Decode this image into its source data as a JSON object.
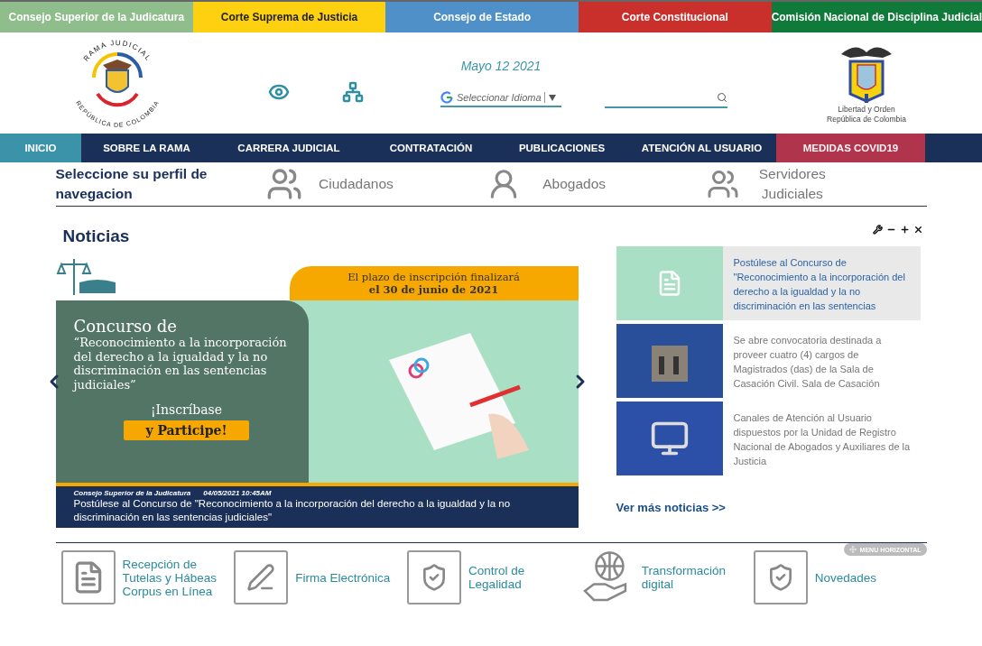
{
  "entity_bar": [
    {
      "label": "Consejo Superior de la Judicatura",
      "color": "#8fbe8c"
    },
    {
      "label": "Corte Suprema de Justicia",
      "color": "#fdd10f"
    },
    {
      "label": "Consejo de Estado",
      "color": "#4f90c8"
    },
    {
      "label": "Corte Constitucional",
      "color": "#c9302c"
    },
    {
      "label": "Comisión Nacional de Disciplina Judicial",
      "color": "#0f7a3a"
    }
  ],
  "header": {
    "logo_text": {
      "top": "RAMA JUDICIAL",
      "bottom": "REPÚBLICA DE COLOMBIA"
    },
    "date": "Mayo 12 2021",
    "language": {
      "label": "Seleccionar Idioma"
    },
    "crest_caption": [
      "Libertad y Orden",
      "República de Colombia"
    ]
  },
  "nav": [
    {
      "label": "INICIO",
      "selected": true,
      "kind": "normal"
    },
    {
      "label": "SOBRE LA RAMA",
      "selected": false,
      "kind": "normal"
    },
    {
      "label": "CARRERA JUDICIAL",
      "selected": false,
      "kind": "normal"
    },
    {
      "label": "CONTRATACIÓN",
      "selected": false,
      "kind": "normal"
    },
    {
      "label": "PUBLICACIONES",
      "selected": false,
      "kind": "normal"
    },
    {
      "label": "ATENCIÓN AL USUARIO",
      "selected": false,
      "kind": "normal"
    },
    {
      "label": "MEDIDAS COVID19",
      "selected": false,
      "kind": "highlight"
    }
  ],
  "profile": {
    "title": "Seleccione su perfil de navegacion",
    "items": [
      {
        "label": "Ciudadanos",
        "kind": "group"
      },
      {
        "label": "Abogados",
        "kind": "lawyer"
      },
      {
        "label": "Servidores Judiciales",
        "kind": "servers"
      }
    ]
  },
  "news": {
    "title": "Noticias",
    "banner": {
      "deadline": [
        "El plazo de inscripción finalizará",
        "el 30 de junio de 2021"
      ],
      "heading": "Concurso de",
      "subtitle": "“Reconocimiento a la incorporación del derecho a la igualdad y la no discriminación en las sentencias judiciales”",
      "call": "¡Inscríbase",
      "button": "y Participe!"
    },
    "caption": {
      "source": "Consejo Superior de la Judicatura",
      "date": "04/05/2021 10:45AM",
      "title": "Postúlese al Concurso de \"Reconocimiento a la incorporación del derecho a la igualdad y la no discriminación en las sentencias judiciales\""
    },
    "items": [
      {
        "title": "Postúlese al Concurso de \"Reconocimiento a la incorporación del derecho a la igualdad y la no discriminación en las sentencias",
        "selected": true,
        "kind": "poster"
      },
      {
        "title": "Se abre convocatoria destinada a proveer cuatro (4) cargos de Magistrados (das) de la Sala de Casación Civil. Sala de Casación",
        "selected": false,
        "kind": "building"
      },
      {
        "title": "Canales de Atención al Usuario dispuestos por la Unidad de Registro Nacional de Abogados y Auxiliares de la Justicia",
        "selected": false,
        "kind": "laptop"
      }
    ],
    "more_link": "Ver más noticias >>"
  },
  "services": {
    "badge": "MENU HORIZONTAL",
    "items": [
      {
        "label": "Recepción de Tutelas y Hábeas Corpus en Línea",
        "kind": "document"
      },
      {
        "label": "Firma Electrónica",
        "kind": "signature"
      },
      {
        "label": "Control de Legalidad",
        "kind": "monitor"
      },
      {
        "label": "Transformación digital",
        "kind": "globe"
      },
      {
        "label": "Novedades",
        "kind": "monitor"
      }
    ]
  }
}
